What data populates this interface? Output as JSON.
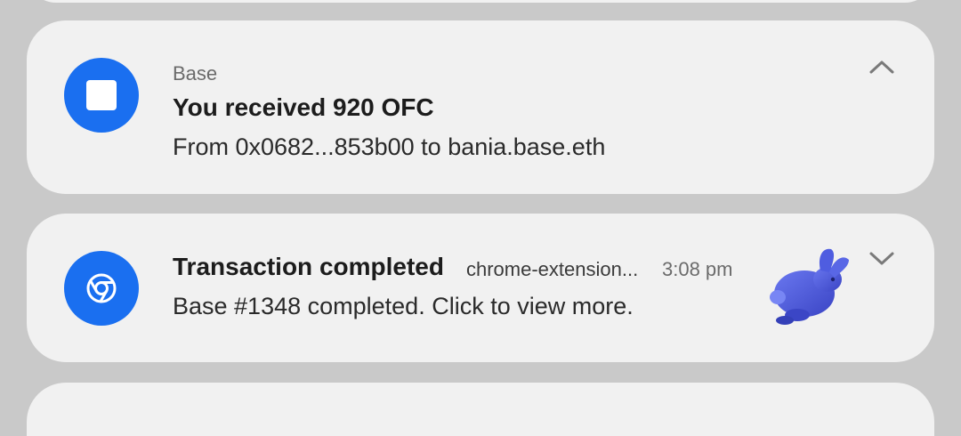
{
  "notifications": [
    {
      "app_name": "Base",
      "title": "You received 920 OFC",
      "body": "From 0x0682...853b00 to bania.base.eth",
      "icon": "base-square-icon",
      "expand_state": "collapse-chevron-up-icon"
    },
    {
      "title": "Transaction completed",
      "source": "chrome-extension...",
      "time": "3:08 pm",
      "body": "Base #1348 completed. Click to view more.",
      "icon": "chrome-icon",
      "thumbnail": "blue-rabbit-image",
      "expand_state": "expand-chevron-down-icon"
    }
  ],
  "colors": {
    "background": "#c9c9c9",
    "card": "#f1f1f1",
    "icon_blue": "#1a6ff0",
    "rabbit": "#4a57d6"
  }
}
